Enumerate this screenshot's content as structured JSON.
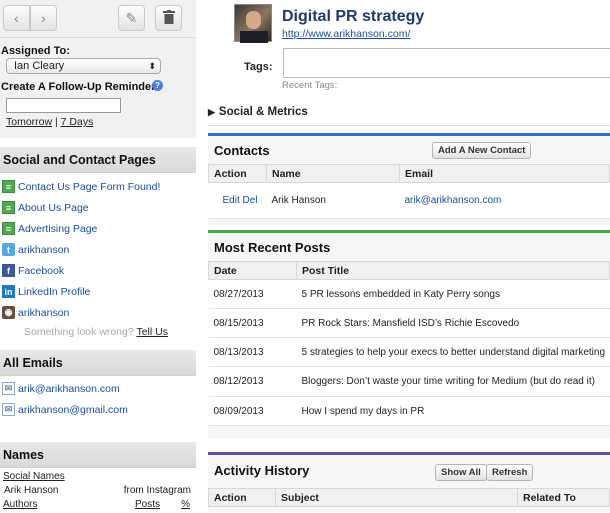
{
  "sidebar": {
    "assign": {
      "assigned_label": "Assigned To:",
      "assignee": "Ian Cleary",
      "reminder_label": "Create A Follow-Up Reminder:",
      "help": "?",
      "tomorrow": "Tomorrow",
      "sep": "|",
      "seven_days": "7 Days"
    },
    "social": {
      "title": "Social and Contact Pages",
      "items": [
        {
          "label": "Contact Us Page Form Found!",
          "icon": "page-icon"
        },
        {
          "label": "About Us Page",
          "icon": "page-icon"
        },
        {
          "label": "Advertising Page",
          "icon": "page-icon"
        },
        {
          "label": "arikhanson",
          "icon": "twitter-icon"
        },
        {
          "label": "Facebook",
          "icon": "facebook-icon"
        },
        {
          "label": "LinkedIn Profile",
          "icon": "linkedin-icon"
        },
        {
          "label": "arikhanson",
          "icon": "instagram-icon"
        }
      ],
      "wrong_text": "Something look wrong?",
      "tell_us": "Tell Us"
    },
    "emails": {
      "title": "All Emails",
      "items": [
        "arik@arikhanson.com",
        "arikhanson@gmail.com"
      ]
    },
    "names": {
      "title": "Names",
      "social_names": "Social Names",
      "name": "Arik Hanson",
      "source": "from Instagram",
      "authors": "Authors",
      "posts": "Posts",
      "pct": "%"
    }
  },
  "header": {
    "title": "Digital PR strategy",
    "url": "http://www.arikhanson.com/",
    "tags_label": "Tags:",
    "recent_tags": "Recent Tags:"
  },
  "social_metrics": "Social & Metrics",
  "contacts": {
    "title": "Contacts",
    "add_button": "Add A New Contact",
    "columns": [
      "Action",
      "Name",
      "Email"
    ],
    "rows": [
      {
        "edit": "Edit",
        "del": "Del",
        "name": "Arik Hanson",
        "email": "arik@arikhanson.com"
      }
    ]
  },
  "posts": {
    "title": "Most Recent Posts",
    "columns": [
      "Date",
      "Post Title"
    ],
    "rows": [
      {
        "date": "08/27/2013",
        "title": "5 PR lessons embedded in Katy Perry songs"
      },
      {
        "date": "08/15/2013",
        "title": "PR Rock Stars: Mansfield ISD’s Richie Escovedo"
      },
      {
        "date": "08/13/2013",
        "title": "5 strategies to help your execs to better understand digital marketing"
      },
      {
        "date": "08/12/2013",
        "title": "Bloggers: Don’t waste your time writing for Medium (but do read it)"
      },
      {
        "date": "08/09/2013",
        "title": "How I spend my days in PR"
      }
    ]
  },
  "activity": {
    "title": "Activity History",
    "show_all": "Show All",
    "refresh": "Refresh",
    "columns": [
      "Action",
      "Subject",
      "Related To"
    ]
  },
  "colors": {
    "contacts_bar": "#2c76b8",
    "posts_bar": "#3fa84a",
    "activity_bar": "#6a4c9c",
    "link": "#1a4d9c"
  }
}
